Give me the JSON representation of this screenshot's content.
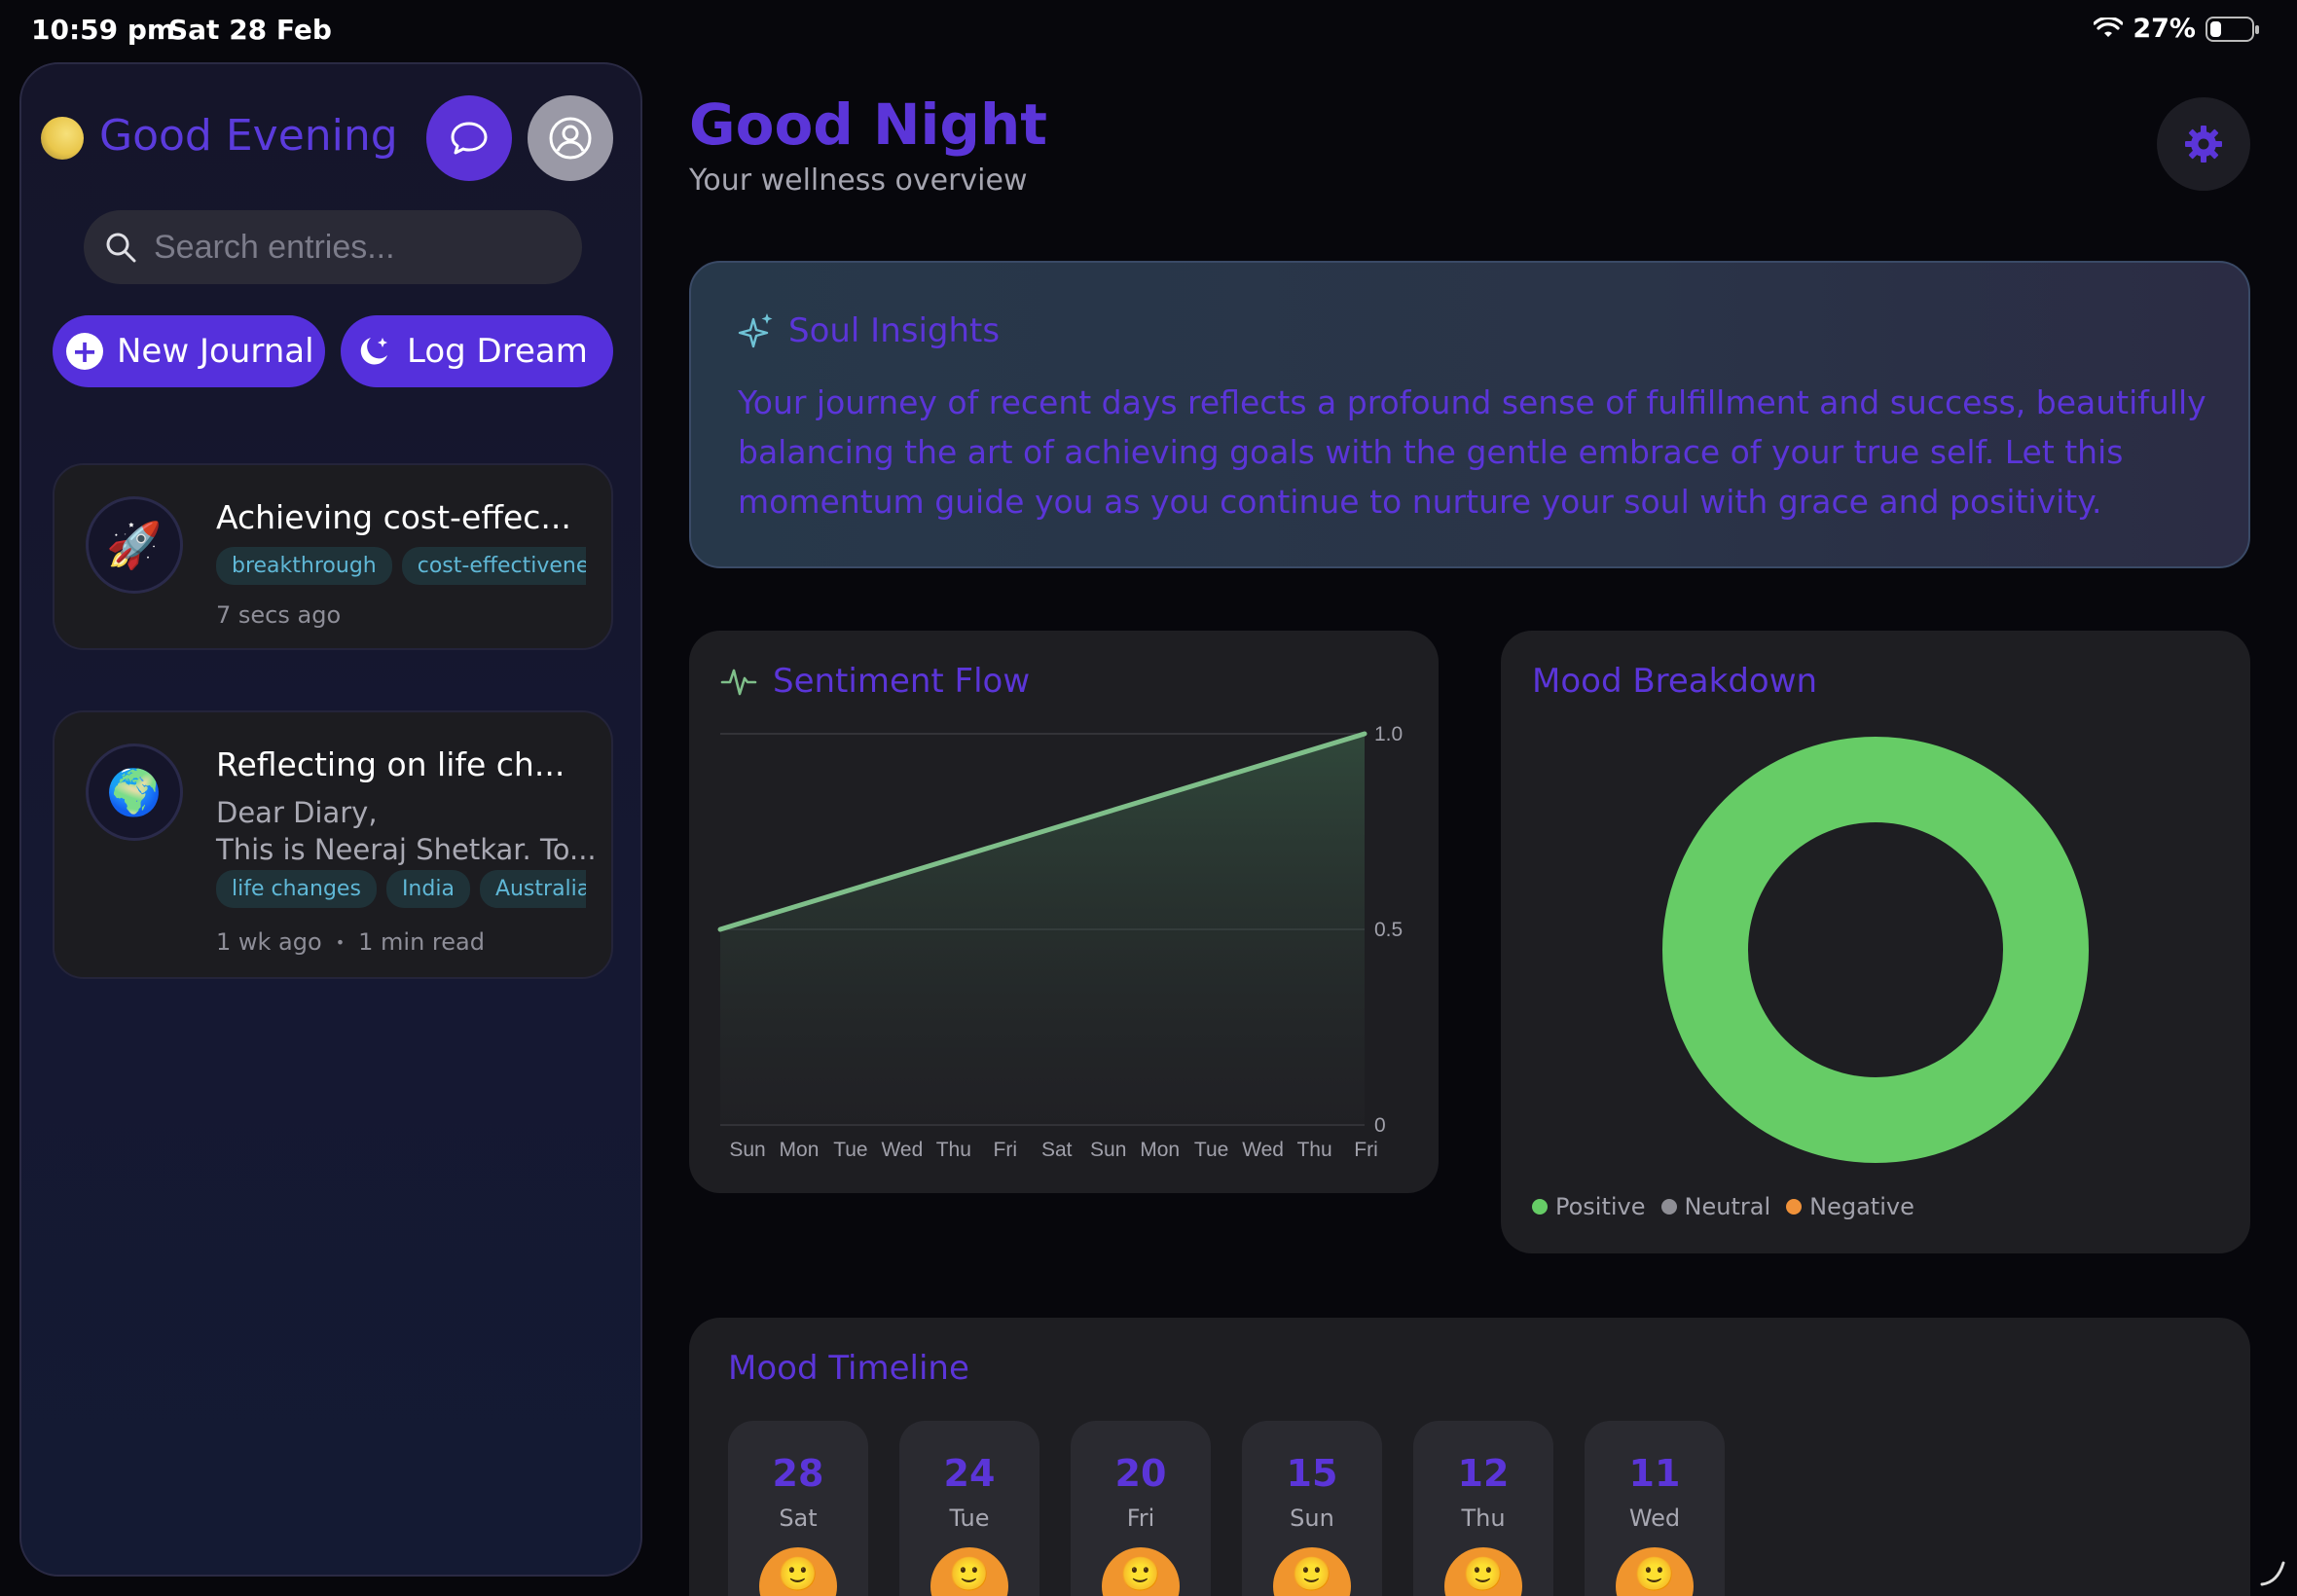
{
  "status_bar": {
    "time": "10:59 pm",
    "date": "Sat 28 Feb",
    "battery": "27%",
    "battery_level": 0.27
  },
  "sidebar": {
    "greeting": "Good Evening",
    "search_placeholder": "Search entries...",
    "new_journal_label": "New Journal",
    "log_dream_label": "Log Dream",
    "entries": [
      {
        "icon": "rocket-icon",
        "title": "Achieving cost-effec...",
        "tags": [
          "breakthrough",
          "cost-effectivenes"
        ],
        "time": "7 secs ago"
      },
      {
        "icon": "globe-icon",
        "title": "Reflecting on life ch...",
        "preview": "Dear Diary,\nThis is Neeraj Shetkar. To...",
        "tags": [
          "life changes",
          "India",
          "Australia"
        ],
        "time": "1 wk ago",
        "read_time": "1 min read"
      }
    ]
  },
  "main": {
    "title": "Good Night",
    "subtitle": "Your wellness overview",
    "insights": {
      "title": "Soul Insights",
      "text": "Your journey of recent days reflects a profound sense of fulfillment and success, beautifully balancing the art of achieving goals with the gentle embrace of your true self. Let this momentum guide you as you continue to nurture your soul with grace and positivity."
    },
    "sentiment": {
      "title": "Sentiment Flow"
    },
    "mood": {
      "title": "Mood Breakdown"
    },
    "timeline": {
      "title": "Mood Timeline",
      "days": [
        {
          "num": "28",
          "name": "Sat"
        },
        {
          "num": "24",
          "name": "Tue"
        },
        {
          "num": "20",
          "name": "Fri"
        },
        {
          "num": "15",
          "name": "Sun"
        },
        {
          "num": "12",
          "name": "Thu"
        },
        {
          "num": "11",
          "name": "Wed"
        }
      ]
    }
  },
  "colors": {
    "accent": "#5b35d8",
    "positive": "#66cc66",
    "neutral": "#8e8e95",
    "negative": "#f0923a",
    "line": "#7fbf8a"
  },
  "chart_data": [
    {
      "type": "area",
      "title": "Sentiment Flow",
      "x": [
        "Sun",
        "Mon",
        "Tue",
        "Wed",
        "Thu",
        "Fri",
        "Sat",
        "Sun",
        "Mon",
        "Tue",
        "Wed",
        "Thu",
        "Fri"
      ],
      "y_ticks": [
        "1.0",
        "0.5",
        "0"
      ],
      "ylim": [
        0,
        1
      ],
      "series": [
        {
          "start": 0.5,
          "end": 1.0
        }
      ],
      "grid": true
    },
    {
      "type": "pie",
      "title": "Mood Breakdown",
      "categories": [
        "Positive",
        "Neutral",
        "Negative"
      ],
      "values": [
        100,
        0,
        0
      ],
      "donut": true,
      "legend": "bottom-left"
    }
  ]
}
